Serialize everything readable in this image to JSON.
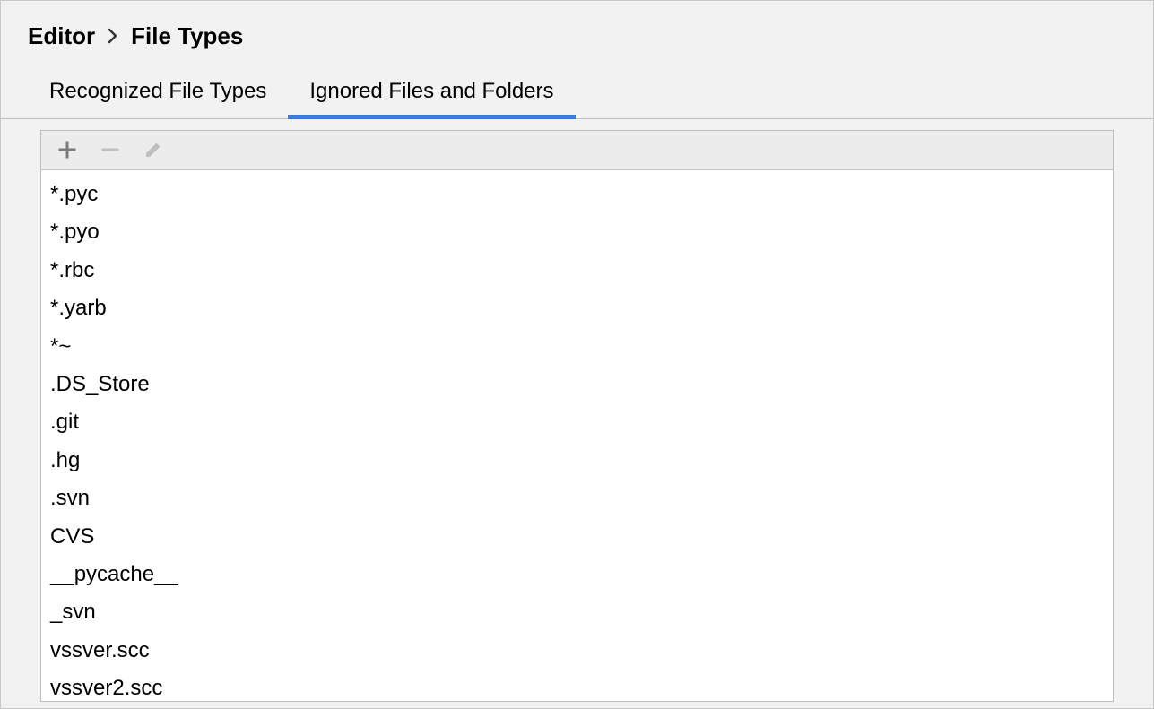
{
  "breadcrumb": {
    "parent": "Editor",
    "current": "File Types"
  },
  "tabs": [
    {
      "label": "Recognized File Types",
      "active": false
    },
    {
      "label": "Ignored Files and Folders",
      "active": true
    }
  ],
  "toolbar": {
    "add_enabled": true,
    "remove_enabled": false,
    "edit_enabled": false
  },
  "ignored_patterns": [
    "*.pyc",
    "*.pyo",
    "*.rbc",
    "*.yarb",
    "*~",
    ".DS_Store",
    ".git",
    ".hg",
    ".svn",
    "CVS",
    "__pycache__",
    "_svn",
    "vssver.scc",
    "vssver2.scc"
  ]
}
